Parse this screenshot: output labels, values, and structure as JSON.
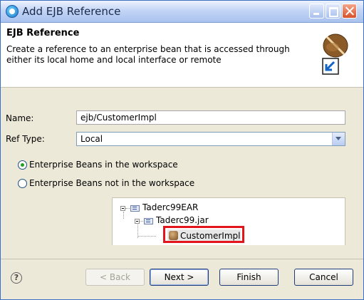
{
  "window": {
    "title": "Add EJB Reference"
  },
  "header": {
    "title": "EJB Reference",
    "description": "Create a reference to an enterprise bean that is accessed through either its local home and local interface or remote"
  },
  "form": {
    "name_label": "Name:",
    "name_value": "ejb/CustomerImpl",
    "reftype_label": "Ref Type:",
    "reftype_value": "Local"
  },
  "options": {
    "in_workspace": "Enterprise Beans in the workspace",
    "not_in_workspace": "Enterprise Beans not in the workspace",
    "selected": "in_workspace"
  },
  "tree": {
    "root": "Taderc99EAR",
    "jar": "Taderc99.jar",
    "bean": "CustomerImpl"
  },
  "buttons": {
    "help": "?",
    "back": "< Back",
    "next": "Next >",
    "finish": "Finish",
    "cancel": "Cancel"
  },
  "colors": {
    "highlight": "#e3141b",
    "title_bar": "#c3d5f6"
  }
}
